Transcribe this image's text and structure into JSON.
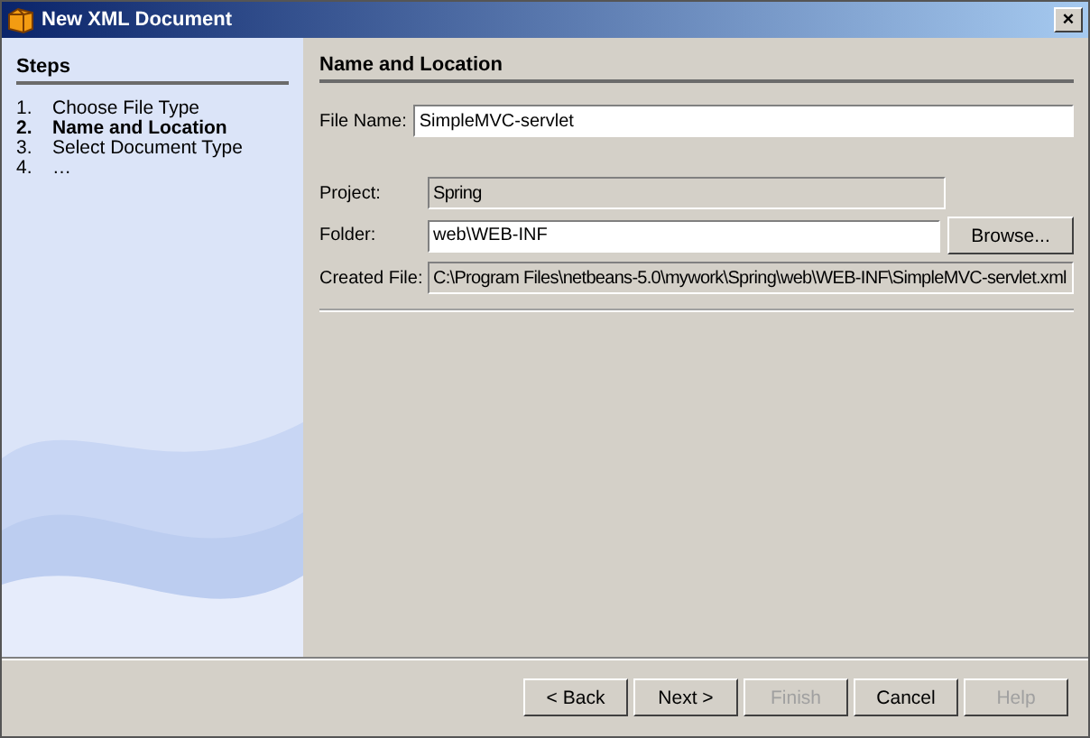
{
  "window": {
    "title": "New XML Document",
    "close": "×"
  },
  "steps": {
    "title": "Steps",
    "items": [
      {
        "number": "1.",
        "label": "Choose File Type",
        "selected": false
      },
      {
        "number": "2.",
        "label": "Name and Location",
        "selected": true
      },
      {
        "number": "3.",
        "label": "Select Document Type",
        "selected": false
      },
      {
        "number": "4.",
        "label": "…",
        "selected": false
      }
    ]
  },
  "panel": {
    "title": "Name and Location",
    "fields": [
      {
        "label": "File Name:",
        "value": "SimpleMVC-servlet",
        "editable": true
      },
      {
        "label": "Project:",
        "value": "Spring",
        "editable": false
      },
      {
        "label": "Folder:",
        "value": "web\\WEB-INF",
        "editable": true,
        "button": "Browse..."
      },
      {
        "label": "Created File:",
        "value": "C:\\Program Files\\netbeans-5.0\\mywork\\Spring\\web\\WEB-INF\\SimpleMVC-servlet.xml",
        "editable": false
      }
    ]
  },
  "buttons": [
    {
      "label": "< Back",
      "disabled": false
    },
    {
      "label": "Next >",
      "disabled": false
    },
    {
      "label": "Finish",
      "disabled": true
    },
    {
      "label": "Cancel",
      "disabled": false
    },
    {
      "label": "Help",
      "disabled": true
    }
  ]
}
